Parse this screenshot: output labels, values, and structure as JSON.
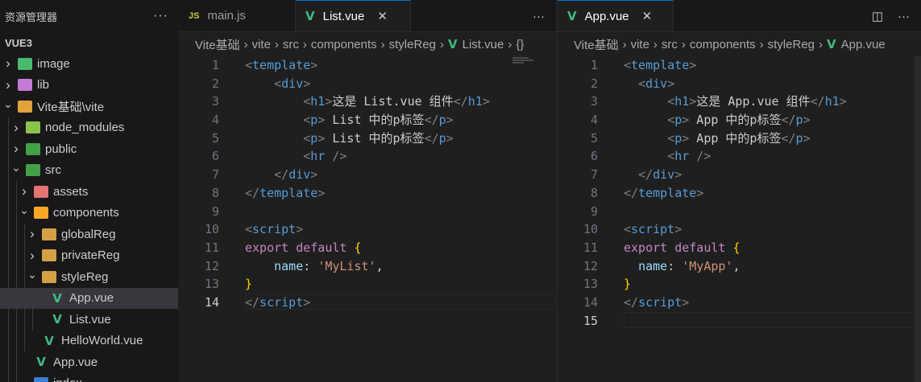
{
  "sidebar": {
    "title": "资源管理器",
    "more": "···",
    "root": "VUE3",
    "items": [
      {
        "label": "image",
        "icon": "image-folder-icon",
        "type": "folder",
        "depth": 0,
        "expanded": false,
        "color": "#4bb870"
      },
      {
        "label": "lib",
        "icon": "lib-folder-icon",
        "type": "folder",
        "depth": 0,
        "expanded": false,
        "color": "#c27ad5"
      },
      {
        "label": "Vite基础\\vite",
        "icon": "folder-open-icon",
        "type": "folder",
        "depth": 0,
        "expanded": true,
        "color": "#e2a23b"
      },
      {
        "label": "node_modules",
        "icon": "node-modules-folder-icon",
        "type": "folder",
        "depth": 1,
        "expanded": false,
        "color": "#8bc34a"
      },
      {
        "label": "public",
        "icon": "public-folder-icon",
        "type": "folder",
        "depth": 1,
        "expanded": false,
        "color": "#43a047"
      },
      {
        "label": "src",
        "icon": "src-folder-icon",
        "type": "folder",
        "depth": 1,
        "expanded": true,
        "color": "#43a047"
      },
      {
        "label": "assets",
        "icon": "assets-folder-icon",
        "type": "folder",
        "depth": 2,
        "expanded": false,
        "color": "#e57373"
      },
      {
        "label": "components",
        "icon": "components-folder-icon",
        "type": "folder",
        "depth": 2,
        "expanded": true,
        "color": "#f9a825"
      },
      {
        "label": "globalReg",
        "icon": "folder-icon",
        "type": "folder",
        "depth": 3,
        "expanded": false,
        "color": "#d4a046"
      },
      {
        "label": "privateReg",
        "icon": "folder-icon",
        "type": "folder",
        "depth": 3,
        "expanded": false,
        "color": "#d4a046"
      },
      {
        "label": "styleReg",
        "icon": "folder-open-icon",
        "type": "folder",
        "depth": 3,
        "expanded": true,
        "color": "#d4a046"
      },
      {
        "label": "App.vue",
        "icon": "vue-file-icon",
        "type": "vue",
        "depth": 4,
        "active": true
      },
      {
        "label": "List.vue",
        "icon": "vue-file-icon",
        "type": "vue",
        "depth": 4
      },
      {
        "label": "HelloWorld.vue",
        "icon": "vue-file-icon",
        "type": "vue",
        "depth": 3
      },
      {
        "label": "App.vue",
        "icon": "vue-file-icon",
        "type": "vue",
        "depth": 2
      },
      {
        "label": "index...",
        "icon": "html-file-icon",
        "type": "html",
        "depth": 2
      }
    ]
  },
  "left_editor": {
    "tabs": [
      {
        "label": "main.js",
        "icon": "js-file-icon",
        "active": false
      },
      {
        "label": "List.vue",
        "icon": "vue-file-icon",
        "active": true,
        "close": "✕"
      }
    ],
    "more": "···",
    "breadcrumb": [
      "Vite基础",
      "vite",
      "src",
      "components",
      "styleReg",
      "List.vue",
      "{}"
    ],
    "current_line": 14,
    "lines": [
      [
        {
          "t": "<",
          "c": "#808080"
        },
        {
          "t": "template",
          "c": "#569cd6"
        },
        {
          "t": ">",
          "c": "#808080"
        }
      ],
      [
        {
          "t": "    "
        },
        {
          "t": "<",
          "c": "#808080"
        },
        {
          "t": "div",
          "c": "#569cd6"
        },
        {
          "t": ">",
          "c": "#808080"
        }
      ],
      [
        {
          "t": "        "
        },
        {
          "t": "<",
          "c": "#808080"
        },
        {
          "t": "h1",
          "c": "#569cd6"
        },
        {
          "t": ">",
          "c": "#808080"
        },
        {
          "t": "这是 List.vue 组件",
          "c": "#cccccc"
        },
        {
          "t": "</",
          "c": "#808080"
        },
        {
          "t": "h1",
          "c": "#569cd6"
        },
        {
          "t": ">",
          "c": "#808080"
        }
      ],
      [
        {
          "t": "        "
        },
        {
          "t": "<",
          "c": "#808080"
        },
        {
          "t": "p",
          "c": "#569cd6"
        },
        {
          "t": ">",
          "c": "#808080"
        },
        {
          "t": " List 中的p标签",
          "c": "#cccccc"
        },
        {
          "t": "</",
          "c": "#808080"
        },
        {
          "t": "p",
          "c": "#569cd6"
        },
        {
          "t": ">",
          "c": "#808080"
        }
      ],
      [
        {
          "t": "        "
        },
        {
          "t": "<",
          "c": "#808080"
        },
        {
          "t": "p",
          "c": "#569cd6"
        },
        {
          "t": ">",
          "c": "#808080"
        },
        {
          "t": " List 中的p标签",
          "c": "#cccccc"
        },
        {
          "t": "</",
          "c": "#808080"
        },
        {
          "t": "p",
          "c": "#569cd6"
        },
        {
          "t": ">",
          "c": "#808080"
        }
      ],
      [
        {
          "t": "        "
        },
        {
          "t": "<",
          "c": "#808080"
        },
        {
          "t": "hr",
          "c": "#569cd6"
        },
        {
          "t": " />",
          "c": "#808080"
        }
      ],
      [
        {
          "t": "    "
        },
        {
          "t": "</",
          "c": "#808080"
        },
        {
          "t": "div",
          "c": "#569cd6"
        },
        {
          "t": ">",
          "c": "#808080"
        }
      ],
      [
        {
          "t": "</",
          "c": "#808080"
        },
        {
          "t": "template",
          "c": "#569cd6"
        },
        {
          "t": ">",
          "c": "#808080"
        }
      ],
      [],
      [
        {
          "t": "<",
          "c": "#808080"
        },
        {
          "t": "script",
          "c": "#569cd6"
        },
        {
          "t": ">",
          "c": "#808080"
        }
      ],
      [
        {
          "t": "export",
          "c": "#c586c0"
        },
        {
          "t": " "
        },
        {
          "t": "default",
          "c": "#c586c0"
        },
        {
          "t": " "
        },
        {
          "t": "{",
          "c": "#ffd700"
        }
      ],
      [
        {
          "t": "    "
        },
        {
          "t": "name",
          "c": "#9cdcfe"
        },
        {
          "t": ": ",
          "c": "#cccccc"
        },
        {
          "t": "'MyList'",
          "c": "#ce9178"
        },
        {
          "t": ",",
          "c": "#cccccc"
        }
      ],
      [
        {
          "t": "}",
          "c": "#ffd700"
        }
      ],
      [
        {
          "t": "</",
          "c": "#808080"
        },
        {
          "t": "script",
          "c": "#569cd6"
        },
        {
          "t": ">",
          "c": "#808080"
        }
      ]
    ]
  },
  "right_editor": {
    "tabs": [
      {
        "label": "App.vue",
        "icon": "vue-file-icon",
        "active": true,
        "close": "✕"
      }
    ],
    "split_icon": "◫",
    "more": "···",
    "breadcrumb": [
      "Vite基础",
      "vite",
      "src",
      "components",
      "styleReg",
      "App.vue"
    ],
    "current_line": 15,
    "lines": [
      [
        {
          "t": "<",
          "c": "#808080"
        },
        {
          "t": "template",
          "c": "#569cd6"
        },
        {
          "t": ">",
          "c": "#808080"
        }
      ],
      [
        {
          "t": "  "
        },
        {
          "t": "<",
          "c": "#808080"
        },
        {
          "t": "div",
          "c": "#569cd6"
        },
        {
          "t": ">",
          "c": "#808080"
        }
      ],
      [
        {
          "t": "      "
        },
        {
          "t": "<",
          "c": "#808080"
        },
        {
          "t": "h1",
          "c": "#569cd6"
        },
        {
          "t": ">",
          "c": "#808080"
        },
        {
          "t": "这是 App.vue 组件",
          "c": "#cccccc"
        },
        {
          "t": "</",
          "c": "#808080"
        },
        {
          "t": "h1",
          "c": "#569cd6"
        },
        {
          "t": ">",
          "c": "#808080"
        }
      ],
      [
        {
          "t": "      "
        },
        {
          "t": "<",
          "c": "#808080"
        },
        {
          "t": "p",
          "c": "#569cd6"
        },
        {
          "t": ">",
          "c": "#808080"
        },
        {
          "t": " App 中的p标签",
          "c": "#cccccc"
        },
        {
          "t": "</",
          "c": "#808080"
        },
        {
          "t": "p",
          "c": "#569cd6"
        },
        {
          "t": ">",
          "c": "#808080"
        }
      ],
      [
        {
          "t": "      "
        },
        {
          "t": "<",
          "c": "#808080"
        },
        {
          "t": "p",
          "c": "#569cd6"
        },
        {
          "t": ">",
          "c": "#808080"
        },
        {
          "t": " App 中的p标签",
          "c": "#cccccc"
        },
        {
          "t": "</",
          "c": "#808080"
        },
        {
          "t": "p",
          "c": "#569cd6"
        },
        {
          "t": ">",
          "c": "#808080"
        }
      ],
      [
        {
          "t": "      "
        },
        {
          "t": "<",
          "c": "#808080"
        },
        {
          "t": "hr",
          "c": "#569cd6"
        },
        {
          "t": " />",
          "c": "#808080"
        }
      ],
      [
        {
          "t": "  "
        },
        {
          "t": "</",
          "c": "#808080"
        },
        {
          "t": "div",
          "c": "#569cd6"
        },
        {
          "t": ">",
          "c": "#808080"
        }
      ],
      [
        {
          "t": "</",
          "c": "#808080"
        },
        {
          "t": "template",
          "c": "#569cd6"
        },
        {
          "t": ">",
          "c": "#808080"
        }
      ],
      [],
      [
        {
          "t": "<",
          "c": "#808080"
        },
        {
          "t": "script",
          "c": "#569cd6"
        },
        {
          "t": ">",
          "c": "#808080"
        }
      ],
      [
        {
          "t": "export",
          "c": "#c586c0"
        },
        {
          "t": " "
        },
        {
          "t": "default",
          "c": "#c586c0"
        },
        {
          "t": " "
        },
        {
          "t": "{",
          "c": "#ffd700"
        }
      ],
      [
        {
          "t": "  "
        },
        {
          "t": "name",
          "c": "#9cdcfe"
        },
        {
          "t": ": ",
          "c": "#cccccc"
        },
        {
          "t": "'MyApp'",
          "c": "#ce9178"
        },
        {
          "t": ",",
          "c": "#cccccc"
        }
      ],
      [
        {
          "t": "}",
          "c": "#ffd700"
        }
      ],
      [
        {
          "t": "</",
          "c": "#808080"
        },
        {
          "t": "script",
          "c": "#569cd6"
        },
        {
          "t": ">",
          "c": "#808080"
        }
      ],
      []
    ]
  }
}
